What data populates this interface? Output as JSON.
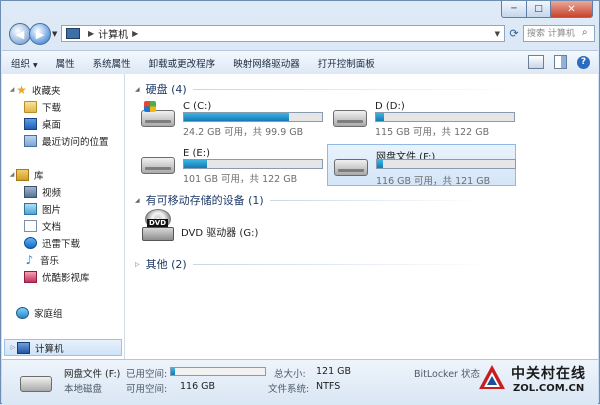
{
  "window": {
    "controls": {
      "minimize": "─",
      "maximize": "□",
      "close": "✕"
    }
  },
  "nav": {
    "back": "◀",
    "forward": "▶",
    "breadcrumb": [
      "计算机"
    ],
    "search_placeholder": "搜索 计算机"
  },
  "toolbar": {
    "items": [
      {
        "label": "组织",
        "has_menu": true
      },
      {
        "label": "属性"
      },
      {
        "label": "系统属性"
      },
      {
        "label": "卸载或更改程序"
      },
      {
        "label": "映射网络驱动器"
      },
      {
        "label": "打开控制面板"
      }
    ]
  },
  "sidebar": {
    "favorites": "收藏夹",
    "fav_items": [
      "下载",
      "桌面",
      "最近访问的位置"
    ],
    "libraries": "库",
    "lib_items": [
      "视频",
      "图片",
      "文档",
      "迅雷下载",
      "音乐",
      "优酷影视库"
    ],
    "homegroup": "家庭组",
    "computer": "计算机"
  },
  "main": {
    "hdd_group": "硬盘 (4)",
    "removable_group": "有可移动存储的设备 (1)",
    "other_group": "其他 (2)",
    "drives": [
      {
        "name": "C (C:)",
        "free": "24.2 GB 可用，共 99.9 GB",
        "used_fraction": 0.76
      },
      {
        "name": "D (D:)",
        "free": "115 GB 可用，共 122 GB",
        "used_fraction": 0.06
      },
      {
        "name": "E (E:)",
        "free": "101 GB 可用，共 122 GB",
        "used_fraction": 0.17
      },
      {
        "name": "网盘文件 (F:)",
        "free": "116 GB 可用，共 121 GB",
        "used_fraction": 0.04
      }
    ],
    "dvd": {
      "name": "DVD 驱动器 (G:)",
      "badge": "DVD"
    }
  },
  "details": {
    "name": "网盘文件 (F:)",
    "type": "本地磁盘",
    "used_label": "已用空间:",
    "used_fraction": 0.04,
    "free_label": "可用空间:",
    "free_value": "116 GB",
    "total_label": "总大小:",
    "total_value": "121 GB",
    "fs_label": "文件系统:",
    "fs_value": "NTFS",
    "bitlocker": "BitLocker 状态"
  },
  "watermark": {
    "cn": "中关村在线",
    "en": "ZOL.COM.CN"
  }
}
